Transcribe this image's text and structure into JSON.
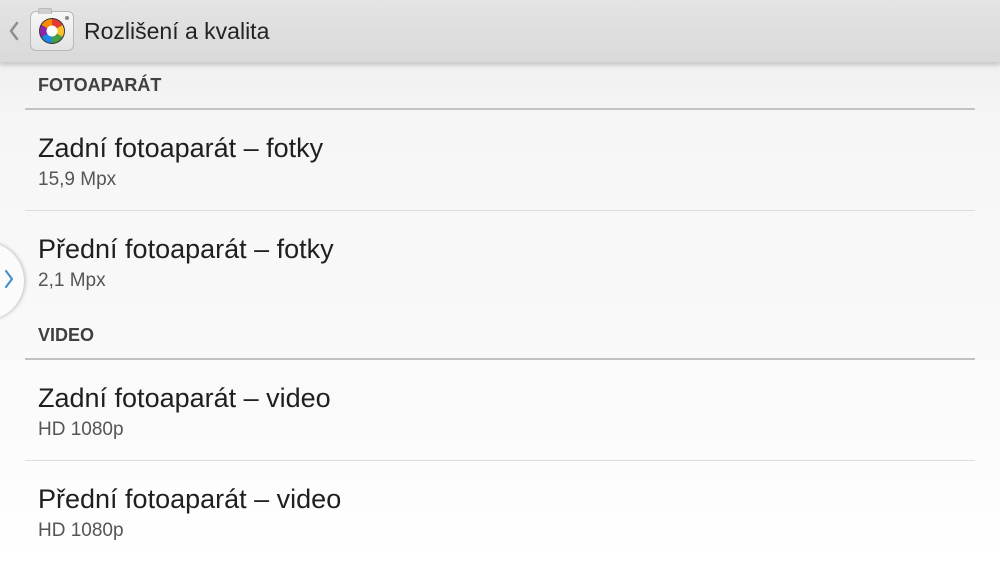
{
  "action_bar": {
    "title": "Rozlišení a kvalita",
    "up_icon": "back-chevron-icon",
    "app_icon": "camera-app-icon"
  },
  "sections": [
    {
      "header": "FOTOAPARÁT",
      "items": [
        {
          "title": "Zadní fotoaparát – fotky",
          "summary": "15,9 Mpx"
        },
        {
          "title": "Přední fotoaparát – fotky",
          "summary": "2,1 Mpx"
        }
      ]
    },
    {
      "header": "VIDEO",
      "items": [
        {
          "title": "Zadní fotoaparát – video",
          "summary": "HD 1080p"
        },
        {
          "title": "Přední fotoaparát – video",
          "summary": "HD 1080p"
        }
      ]
    }
  ],
  "side_handle": {
    "icon": "chevron-right-icon",
    "color": "#4a90c8"
  },
  "colors": {
    "action_bar_bg": "#dcdcdc",
    "section_divider": "#c2c2c2",
    "item_divider": "#dddddd",
    "accent": "#4a90c8"
  }
}
